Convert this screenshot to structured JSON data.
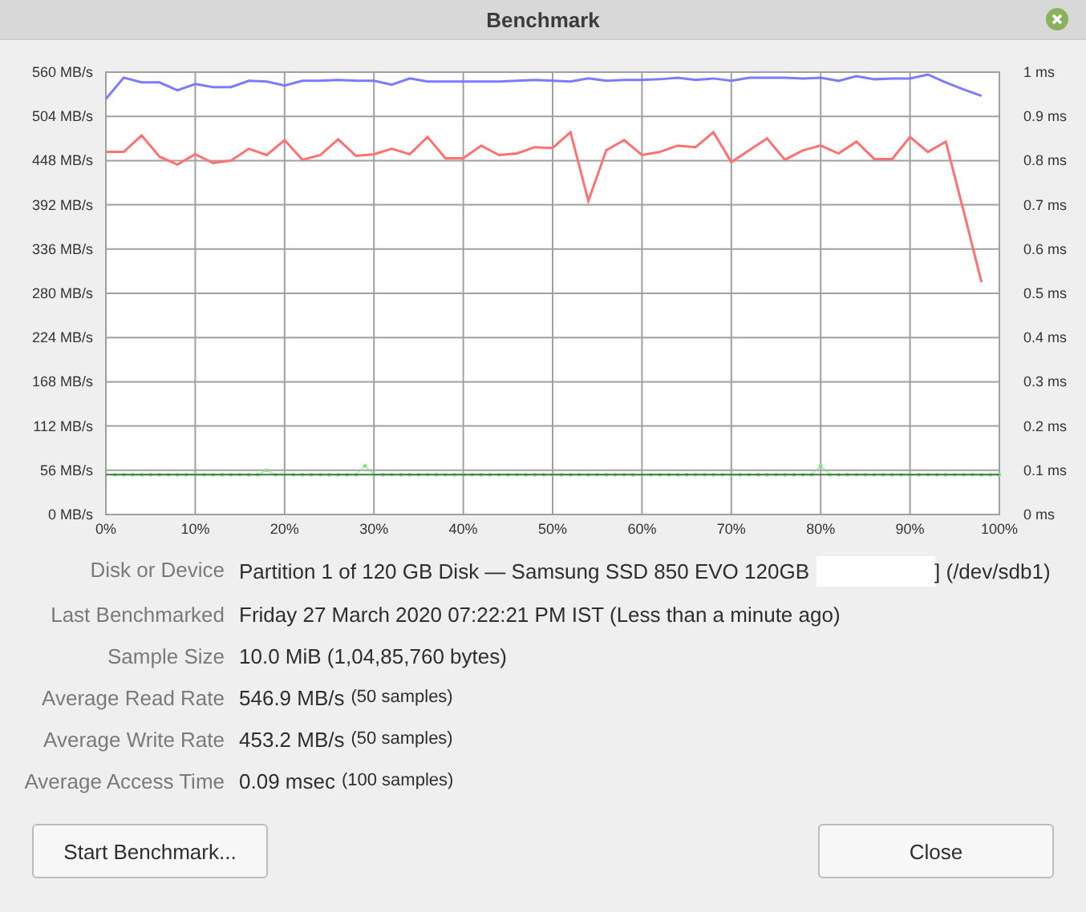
{
  "window": {
    "title": "Benchmark"
  },
  "chart_data": {
    "type": "line",
    "x": [
      0,
      2,
      4,
      6,
      8,
      10,
      12,
      14,
      16,
      18,
      20,
      22,
      24,
      26,
      28,
      30,
      32,
      34,
      36,
      38,
      40,
      42,
      44,
      46,
      48,
      50,
      52,
      54,
      56,
      58,
      60,
      62,
      64,
      66,
      68,
      70,
      72,
      74,
      76,
      78,
      80,
      82,
      84,
      86,
      88,
      90,
      92,
      94,
      96,
      98
    ],
    "grid": true,
    "ref_lines": [
      {
        "value": 0.09,
        "axis": "y2",
        "color": "#3d7a3d"
      }
    ],
    "xlim": [
      0,
      100
    ],
    "ylim": [
      0,
      560
    ],
    "y2lim": [
      0,
      1
    ],
    "xticks": [
      {
        "value": 0,
        "label": "0%"
      },
      {
        "value": 10,
        "label": "10%"
      },
      {
        "value": 20,
        "label": "20%"
      },
      {
        "value": 30,
        "label": "30%"
      },
      {
        "value": 40,
        "label": "40%"
      },
      {
        "value": 50,
        "label": "50%"
      },
      {
        "value": 60,
        "label": "60%"
      },
      {
        "value": 70,
        "label": "70%"
      },
      {
        "value": 80,
        "label": "80%"
      },
      {
        "value": 90,
        "label": "90%"
      },
      {
        "value": 100,
        "label": "100%"
      }
    ],
    "yticks": [
      {
        "value": 0,
        "label": "0 MB/s"
      },
      {
        "value": 56,
        "label": "56 MB/s"
      },
      {
        "value": 112,
        "label": "112 MB/s"
      },
      {
        "value": 168,
        "label": "168 MB/s"
      },
      {
        "value": 224,
        "label": "224 MB/s"
      },
      {
        "value": 280,
        "label": "280 MB/s"
      },
      {
        "value": 336,
        "label": "336 MB/s"
      },
      {
        "value": 392,
        "label": "392 MB/s"
      },
      {
        "value": 448,
        "label": "448 MB/s"
      },
      {
        "value": 504,
        "label": "504 MB/s"
      },
      {
        "value": 560,
        "label": "560 MB/s"
      }
    ],
    "y2ticks": [
      {
        "value": 0,
        "label": "0 ms"
      },
      {
        "value": 0.1,
        "label": "0.1 ms"
      },
      {
        "value": 0.2,
        "label": "0.2 ms"
      },
      {
        "value": 0.3,
        "label": "0.3 ms"
      },
      {
        "value": 0.4,
        "label": "0.4 ms"
      },
      {
        "value": 0.5,
        "label": "0.5 ms"
      },
      {
        "value": 0.6,
        "label": "0.6 ms"
      },
      {
        "value": 0.7,
        "label": "0.7 ms"
      },
      {
        "value": 0.8,
        "label": "0.8 ms"
      },
      {
        "value": 0.9,
        "label": "0.9 ms"
      },
      {
        "value": 1,
        "label": "1 ms"
      }
    ],
    "series": [
      {
        "color": "#7b7bff",
        "values": [
          526,
          553,
          547,
          547,
          537,
          545,
          541,
          541,
          549,
          548,
          543,
          549,
          549,
          550,
          549,
          549,
          544,
          552,
          548,
          548,
          548,
          548,
          548,
          549,
          550,
          549,
          548,
          552,
          549,
          550,
          550,
          551,
          553,
          550,
          552,
          549,
          553,
          553,
          553,
          552,
          553,
          549,
          555,
          551,
          552,
          552,
          557,
          547,
          538,
          530
        ]
      },
      {
        "color": "#ff7070",
        "values": [
          459,
          459,
          480,
          453,
          443,
          456,
          445,
          448,
          463,
          455,
          474,
          449,
          455,
          475,
          454,
          456,
          463,
          456,
          478,
          451,
          451,
          467,
          455,
          457,
          465,
          464,
          484,
          397,
          461,
          474,
          455,
          459,
          467,
          465,
          484,
          446,
          461,
          476,
          449,
          461,
          467,
          457,
          472,
          450,
          450,
          478,
          459,
          472,
          384,
          294
        ]
      },
      {
        "axis": "y2",
        "color": "#7ee87e",
        "x": [
          1,
          2,
          3,
          4,
          5,
          6,
          7,
          9,
          10,
          11,
          13,
          14,
          16,
          17,
          18,
          19,
          20,
          21,
          23,
          24,
          25,
          26,
          27,
          29,
          30,
          32,
          33,
          34,
          37,
          38,
          39,
          40,
          42,
          43,
          44,
          45,
          46,
          48,
          49,
          51,
          52,
          54,
          56,
          57,
          58,
          59,
          60,
          61,
          62,
          63,
          65,
          66,
          67,
          68,
          70,
          71,
          72,
          73,
          74,
          76,
          77,
          78,
          79,
          80,
          82,
          83,
          84,
          85,
          86,
          88,
          89,
          90,
          91,
          92,
          93,
          94,
          95,
          96,
          97,
          98,
          99,
          8,
          12,
          15,
          22,
          28,
          31,
          35,
          36,
          41,
          47,
          50,
          53,
          55,
          64,
          69,
          75,
          81,
          87,
          100
        ],
        "values": [
          0.09,
          0.09,
          0.09,
          0.09,
          0.09,
          0.09,
          0.09,
          0.09,
          0.09,
          0.09,
          0.09,
          0.09,
          0.09,
          0.09,
          0.1,
          0.09,
          0.09,
          0.09,
          0.09,
          0.09,
          0.09,
          0.09,
          0.09,
          0.11,
          0.09,
          0.09,
          0.09,
          0.09,
          0.09,
          0.09,
          0.09,
          0.09,
          0.09,
          0.09,
          0.09,
          0.09,
          0.09,
          0.09,
          0.09,
          0.09,
          0.09,
          0.09,
          0.09,
          0.09,
          0.09,
          0.09,
          0.09,
          0.09,
          0.09,
          0.09,
          0.09,
          0.09,
          0.09,
          0.09,
          0.09,
          0.09,
          0.09,
          0.09,
          0.09,
          0.09,
          0.09,
          0.09,
          0.09,
          0.11,
          0.09,
          0.09,
          0.09,
          0.09,
          0.09,
          0.09,
          0.09,
          0.09,
          0.09,
          0.09,
          0.09,
          0.09,
          0.09,
          0.09,
          0.09,
          0.09,
          0.09,
          0.09,
          0.09,
          0.09,
          0.09,
          0.09,
          0.09,
          0.09,
          0.09,
          0.09,
          0.09,
          0.09,
          0.09,
          0.09,
          0.09,
          0.09,
          0.09,
          0.09,
          0.09,
          0.09
        ]
      }
    ]
  },
  "details": [
    {
      "label": "Disk or Device",
      "value": "Partition 1 of 120 GB Disk — Samsung SSD 850 EVO 120GB",
      "redacted": true,
      "value_after": "] (/dev/sdb1)"
    },
    {
      "label": "Last Benchmarked",
      "value": "Friday 27 March 2020 07:22:21 PM IST (Less than a minute ago)"
    },
    {
      "label": "Sample Size",
      "value": "10.0 MiB (1,04,85,760 bytes)"
    },
    {
      "label": "Average Read Rate",
      "value": "546.9 MB/s",
      "note": "(50 samples)"
    },
    {
      "label": "Average Write Rate",
      "value": "453.2 MB/s",
      "note": "(50 samples)"
    },
    {
      "label": "Average Access Time",
      "value": "0.09 msec",
      "note": "(100 samples)"
    }
  ],
  "buttons": [
    {
      "label": "Start Benchmark..."
    },
    {
      "label": "Close"
    }
  ]
}
